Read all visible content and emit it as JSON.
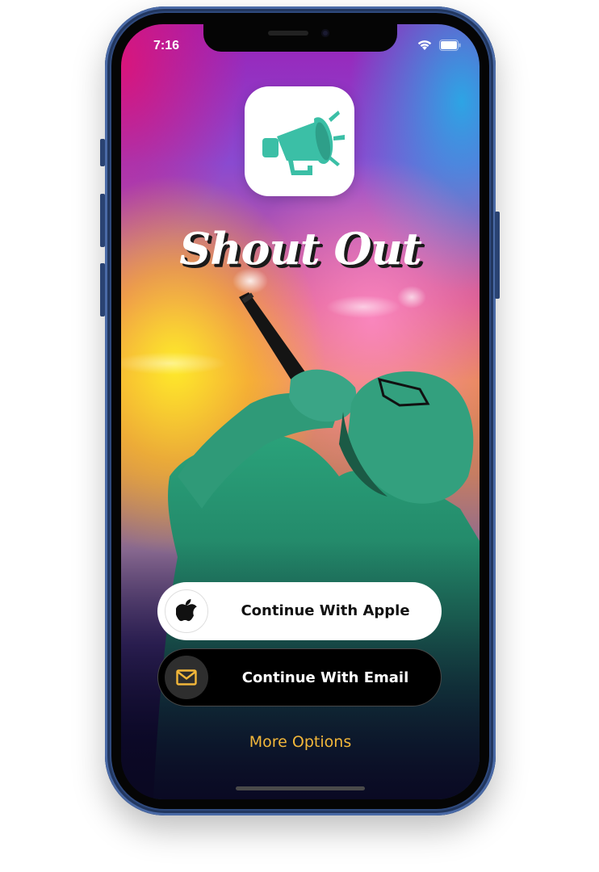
{
  "status_bar": {
    "time": "7:16",
    "icons": [
      "wifi-icon",
      "battery-icon"
    ]
  },
  "app": {
    "logo_icon": "megaphone-icon",
    "title": "Shout Out"
  },
  "buttons": {
    "apple_label": "Continue With Apple",
    "apple_icon": "apple-logo-icon",
    "email_label": "Continue With Email",
    "email_icon": "envelope-icon"
  },
  "more_options_label": "More Options",
  "colors": {
    "logo_teal": "#3bbfa6",
    "more_options": "#f2b73a",
    "email_icon": "#f2b73a"
  }
}
